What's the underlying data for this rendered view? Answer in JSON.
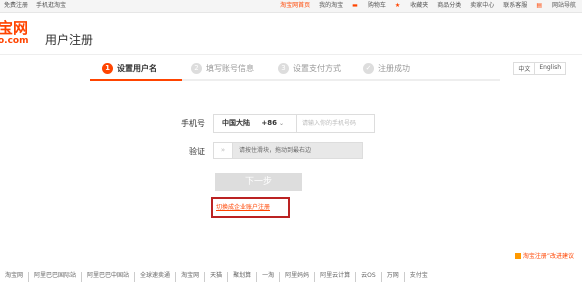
{
  "topbar": {
    "left": [
      "免费注册",
      "手机逛淘宝"
    ],
    "right": [
      "淘宝网首页",
      "我的淘宝",
      "购物车",
      "收藏夹",
      "商品分类",
      "卖家中心",
      "联系客服",
      "网站导航"
    ]
  },
  "header": {
    "logo_line1": "宝网",
    "logo_line2": "o.com",
    "title": "用户注册"
  },
  "steps": [
    {
      "num": "1",
      "label": "设置用户名",
      "active": true
    },
    {
      "num": "2",
      "label": "填写账号信息",
      "active": false
    },
    {
      "num": "3",
      "label": "设置支付方式",
      "active": false
    },
    {
      "num": "✓",
      "label": "注册成功",
      "active": false
    }
  ],
  "lang": [
    "中文",
    "English"
  ],
  "form": {
    "phone_label": "手机号",
    "country": "中国大陆",
    "prefix": "+86",
    "phone_placeholder": "请输入你的手机号码",
    "verify_label": "验证",
    "slider_text": "请按住滑块，拖动到最右边",
    "next_button": "下一步",
    "enterprise_link": "切换成企业账户注册"
  },
  "feedback": "淘宝注册”改进建议",
  "footer": [
    "淘宝网",
    "阿里巴巴国际站",
    "阿里巴巴中国站",
    "全球速卖通",
    "淘宝网",
    "天猫",
    "聚划算",
    "一淘",
    "阿里妈妈",
    "阿里云计算",
    "云OS",
    "万网",
    "支付宝"
  ]
}
